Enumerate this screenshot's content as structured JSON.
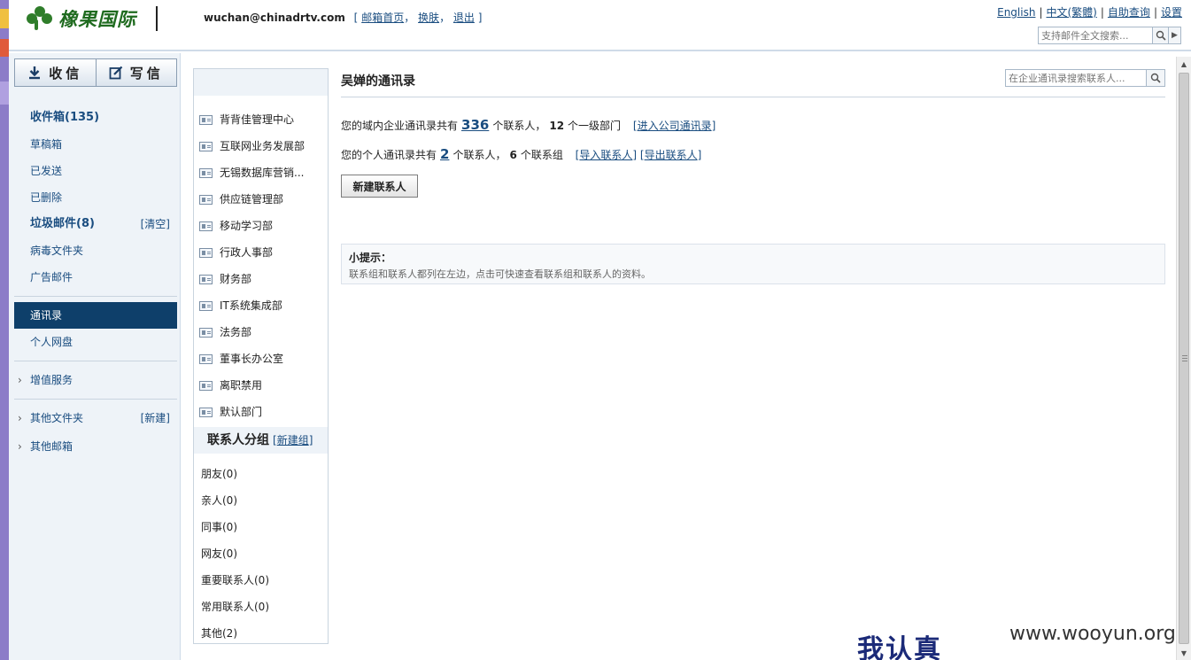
{
  "header": {
    "logo_text": "橡果国际",
    "user_email": "wuchan@chinadrtv.com",
    "user_links": [
      "邮箱首页",
      "换肤",
      "退出"
    ],
    "top_links": [
      "English",
      "中文(繁體)",
      "自助查询",
      "设置"
    ],
    "search_placeholder": "支持邮件全文搜索..."
  },
  "compose": {
    "receive_label": "收信",
    "write_label": "写信"
  },
  "nav": {
    "inbox": "收件箱(135)",
    "drafts": "草稿箱",
    "sent": "已发送",
    "deleted": "已删除",
    "spam": "垃圾邮件(8)",
    "spam_clear": "[清空]",
    "virus": "病毒文件夹",
    "ads": "广告邮件",
    "contacts": "通讯录",
    "netdisk": "个人网盘",
    "value_added": "增值服务",
    "other_folders": "其他文件夹",
    "other_folders_new": "[新建]",
    "other_mailboxes": "其他邮箱"
  },
  "departments": [
    "背背佳管理中心",
    "互联网业务发展部",
    "无锡数据库营销...",
    "供应链管理部",
    "移动学习部",
    "行政人事部",
    "财务部",
    "IT系统集成部",
    "法务部",
    "董事长办公室",
    "离职禁用",
    "默认部门"
  ],
  "groups_panel": {
    "title": "联系人分组",
    "new_group": "新建组",
    "groups": [
      "朋友(0)",
      "亲人(0)",
      "同事(0)",
      "网友(0)",
      "重要联系人(0)",
      "常用联系人(0)",
      "其他(2)"
    ]
  },
  "main": {
    "title": "吴婵的通讯录",
    "search_placeholder": "在企业通讯录搜索联系人...",
    "line1_prefix": "您的域内企业通讯录共有",
    "line1_count": "336",
    "line1_mid": "个联系人，",
    "line1_depts": "12",
    "line1_suffix": "个一级部门",
    "line1_link": "进入公司通讯录",
    "line2_prefix": "您的个人通讯录共有",
    "line2_count": "2",
    "line2_mid": "个联系人，",
    "line2_groups": "6",
    "line2_suffix": "个联系组",
    "line2_import": "导入联系人",
    "line2_export": "导出联系人",
    "new_contact_button": "新建联系人",
    "tip_title": "小提示：",
    "tip_body": "联系组和联系人都列在左边，点击可快速查看联系组和联系人的资料。"
  },
  "watermark": {
    "cn": "我认真",
    "url": "www.wooyun.org"
  }
}
